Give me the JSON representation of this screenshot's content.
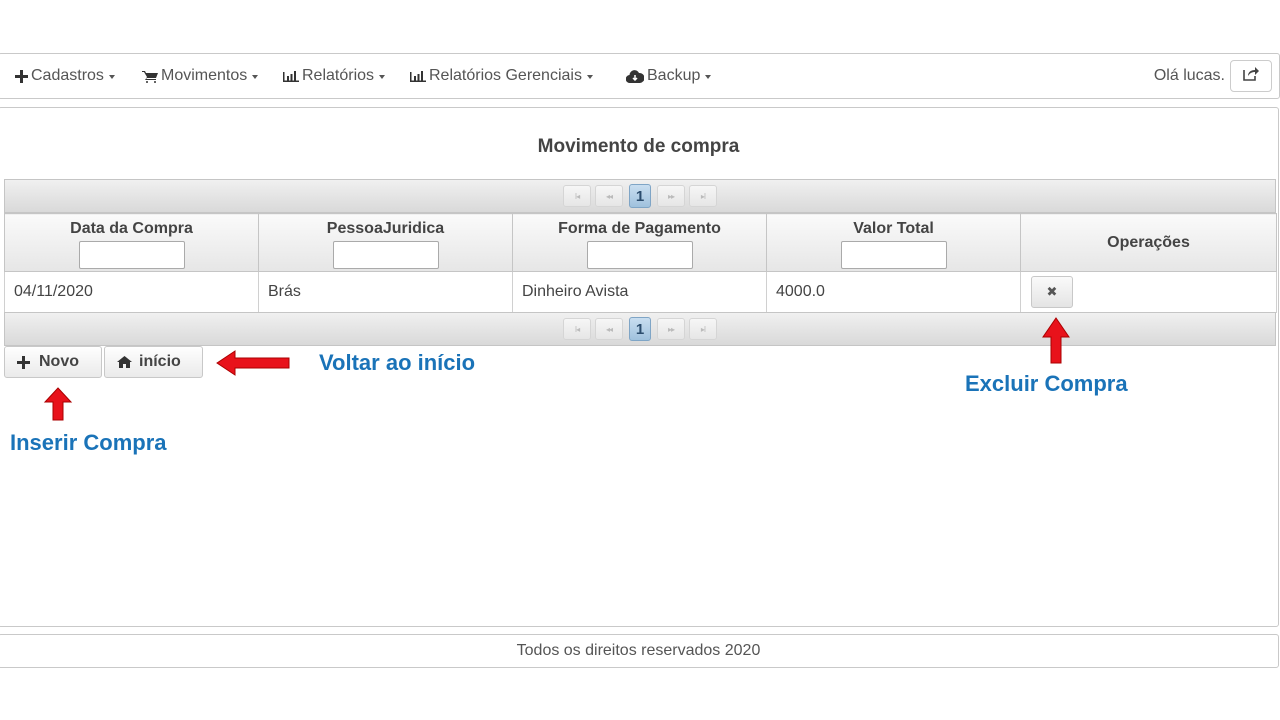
{
  "nav": {
    "cadastros": "Cadastros",
    "movimentos": "Movimentos",
    "relatorios": "Relatórios",
    "relatorios_gerenciais": "Relatórios Gerenciais",
    "backup": "Backup",
    "greeting": "Olá lucas."
  },
  "page": {
    "title": "Movimento de compra"
  },
  "paginator": {
    "current_page": "1"
  },
  "table": {
    "columns": [
      "Data da Compra",
      "PessoaJuridica",
      "Forma de Pagamento",
      "Valor Total",
      "Operações"
    ],
    "rows": [
      [
        "04/11/2020",
        "Brás",
        "Dinheiro Avista",
        "4000.0"
      ]
    ]
  },
  "actions": {
    "novo": "Novo",
    "inicio": "início"
  },
  "annotations": {
    "voltar": "Voltar ao início",
    "excluir": "Excluir Compra",
    "inserir": "Inserir Compra"
  },
  "footer": {
    "text": "Todos os direitos reservados 2020"
  },
  "colors": {
    "annotation": "#1a73b8",
    "arrow": "#e8121b",
    "page_active": "#9fc1dd"
  },
  "icons": [
    "plus-icon",
    "cart-icon",
    "bar-chart-icon",
    "cloud-icon",
    "share-icon",
    "home-icon",
    "close-icon"
  ]
}
